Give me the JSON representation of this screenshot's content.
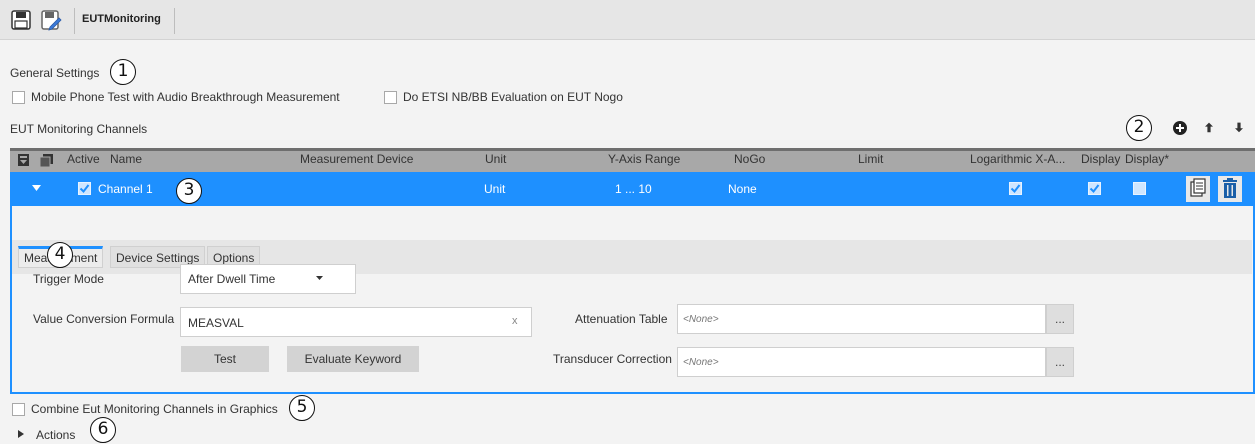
{
  "toolbar": {
    "title": "EUTMonitoring"
  },
  "general": {
    "heading": "General Settings",
    "opt1": "Mobile Phone Test with Audio Breakthrough Measurement",
    "opt2": "Do ETSI NB/BB Evaluation on EUT Nogo"
  },
  "channels": {
    "heading": "EUT Monitoring Channels",
    "columns": {
      "active": "Active",
      "name": "Name",
      "device": "Measurement Device",
      "unit": "Unit",
      "yrange": "Y-Axis Range",
      "nogo": "NoGo",
      "limit": "Limit",
      "log": "Logarithmic X-A...",
      "display": "Display",
      "display2": "Display*"
    },
    "rows": [
      {
        "name": "Channel 1",
        "unit": "Unit",
        "yrange": "1 ... 10",
        "nogo": "None"
      }
    ]
  },
  "detail": {
    "tabs": [
      "Measurement",
      "Device Settings",
      "Options"
    ],
    "trigger_label": "Trigger Mode",
    "trigger_value": "After Dwell Time",
    "formula_label": "Value Conversion Formula",
    "formula_value": "MEASVAL",
    "formula_clear": "x",
    "test_label": "Test",
    "evaluate_label": "Evaluate Keyword",
    "atten_label": "Attenuation Table",
    "atten_value": "<None>",
    "trans_label": "Transducer Correction",
    "trans_value": "<None>",
    "ellipsis": "..."
  },
  "combine_label": "Combine Eut Monitoring Channels in Graphics",
  "actions_label": "Actions",
  "callouts": [
    "1",
    "2",
    "3",
    "4",
    "5",
    "6"
  ],
  "colors": {
    "accent": "#1e90ff",
    "header": "#a8a8a8",
    "delete": "#1a5fa8"
  },
  "icons": [
    "save-icon",
    "save-as-icon",
    "add-icon",
    "arrow-up-icon",
    "arrow-down-icon",
    "expand-all-icon",
    "collapse-all-icon",
    "chevron-down-icon",
    "copy-icon",
    "delete-icon",
    "triangle-right-icon"
  ]
}
